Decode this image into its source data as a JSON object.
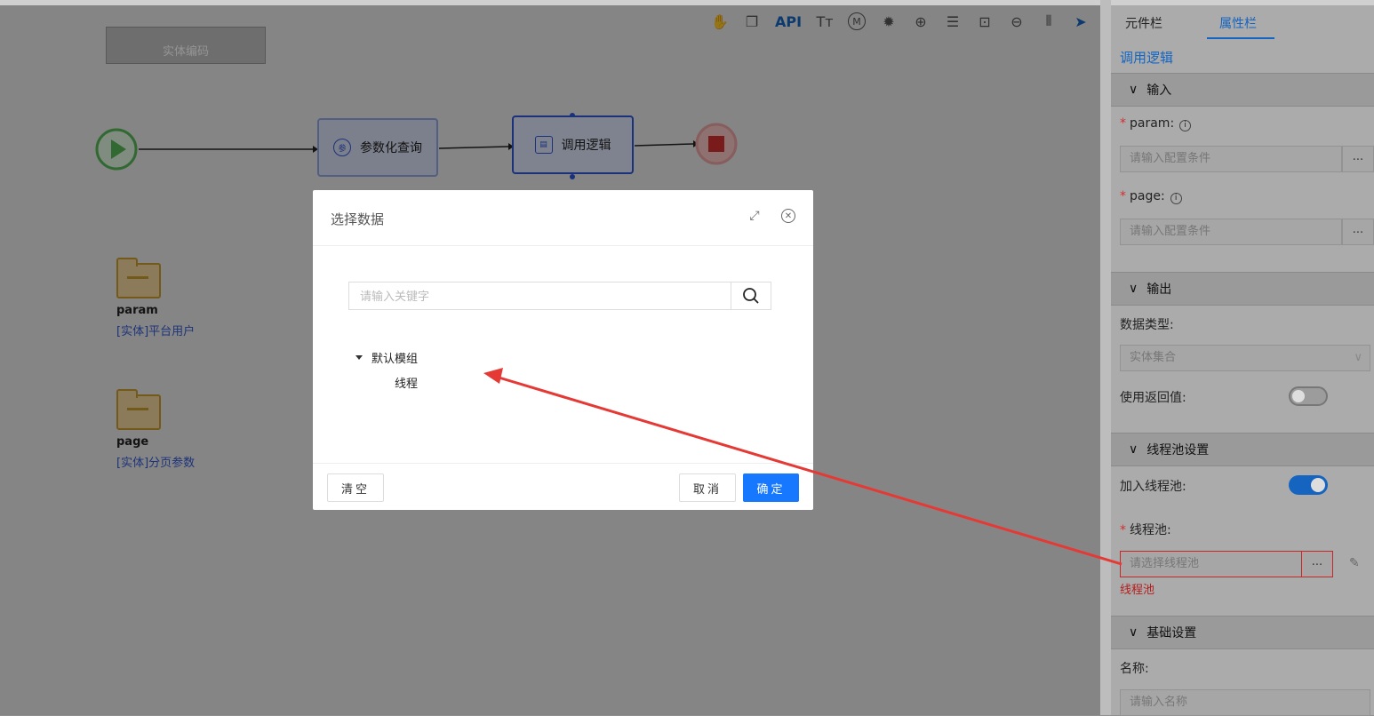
{
  "toolbar": {
    "icons": [
      "hand-icon",
      "copy-icon",
      "api-icon",
      "text-size-icon",
      "m-circle-icon",
      "bug-icon",
      "zoom-in-icon",
      "align-center-icon",
      "fit-icon",
      "zoom-out-icon",
      "columns-icon",
      "send-icon"
    ],
    "api_label": "API",
    "text_label": "Tт",
    "m_label": "M"
  },
  "canvas": {
    "old_node_label": "实体编码",
    "nodes": [
      {
        "label": "参数化查询",
        "icon_text": "参"
      },
      {
        "label": "调用逻辑",
        "icon_text": "▤"
      }
    ],
    "variables": [
      {
        "name": "param",
        "type": "[实体]平台用户"
      },
      {
        "name": "page",
        "type": "[实体]分页参数"
      }
    ]
  },
  "panel": {
    "tabs": [
      "元件栏",
      "属性栏"
    ],
    "active_tab": "属性栏",
    "title": "调用逻辑",
    "sections": {
      "input": "输入",
      "output": "输出",
      "thread_pool": "线程池设置",
      "basic": "基础设置"
    },
    "fields": {
      "param_label": "param:",
      "param_placeholder": "请输入配置条件",
      "page_label": "page:",
      "page_placeholder": "请输入配置条件",
      "data_type_label": "数据类型:",
      "data_type_value": "实体集合",
      "use_return_label": "使用返回值:",
      "join_pool_label": "加入线程池:",
      "pool_label": "线程池:",
      "pool_placeholder": "请选择线程池",
      "pool_error": "线程池",
      "name_label": "名称:",
      "name_placeholder": "请输入名称"
    },
    "dots": "..."
  },
  "modal": {
    "title": "选择数据",
    "search_placeholder": "请输入关键字",
    "tree": {
      "group": "默认模组",
      "children": [
        "线程"
      ]
    },
    "buttons": {
      "clear": "清空",
      "cancel": "取消",
      "confirm": "确定"
    }
  },
  "colors": {
    "accent": "#1677ff",
    "annotation_arrow": "#e53935",
    "error": "#d32f2f"
  }
}
